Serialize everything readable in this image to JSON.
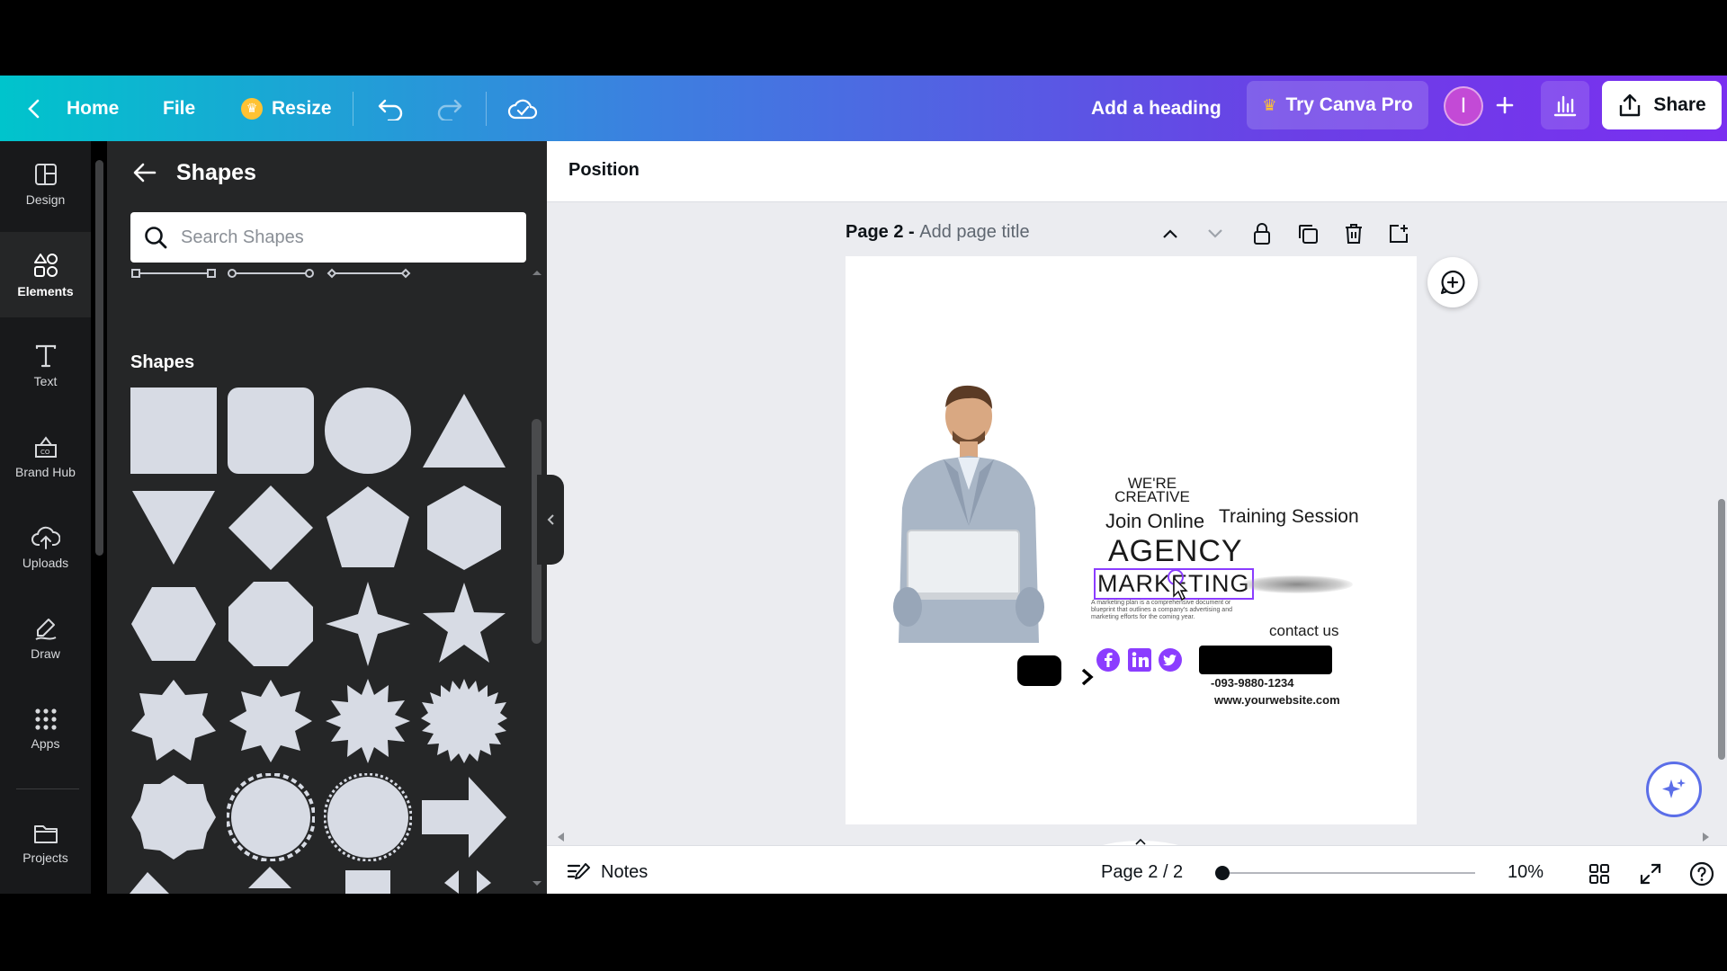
{
  "header": {
    "home_label": "Home",
    "file_label": "File",
    "resize_label": "Resize",
    "heading_label": "Add a heading",
    "pro_label": "Try Canva Pro",
    "avatar_initial": "I",
    "share_label": "Share"
  },
  "rail": {
    "items": [
      {
        "label": "Design",
        "icon": "layout-icon"
      },
      {
        "label": "Elements",
        "icon": "elements-icon"
      },
      {
        "label": "Text",
        "icon": "text-icon"
      },
      {
        "label": "Brand Hub",
        "icon": "brand-hub-icon"
      },
      {
        "label": "Uploads",
        "icon": "upload-cloud-icon"
      },
      {
        "label": "Draw",
        "icon": "draw-icon"
      },
      {
        "label": "Apps",
        "icon": "apps-grid-icon"
      },
      {
        "label": "Projects",
        "icon": "folder-icon"
      }
    ]
  },
  "panel": {
    "title": "Shapes",
    "search_placeholder": "Search Shapes",
    "section_title": "Shapes"
  },
  "editor": {
    "position_label": "Position",
    "page_prefix": "Page 2 - ",
    "page_title_placeholder": "Add page title"
  },
  "design": {
    "creative": "WE'RE CREATIVE",
    "join_online": "Join Online",
    "training": "Training Session",
    "agency": "AGENCY",
    "marketing": "MARKETING",
    "paragraph": "A marketing plan is a comprehensive document or blueprint that outlines a company's advertising and marketing efforts for the coming year.",
    "contact": "contact us",
    "phone": "-093-9880-1234",
    "website": "www.yourwebsite.com"
  },
  "bottombar": {
    "notes_label": "Notes",
    "page_count": "Page 2 / 2",
    "zoom": "10%"
  },
  "colors": {
    "accent_purple": "#8b3dff",
    "header_start": "#00c4cc",
    "header_end": "#7a2ff0",
    "shape_fill": "#d7dbe4"
  }
}
